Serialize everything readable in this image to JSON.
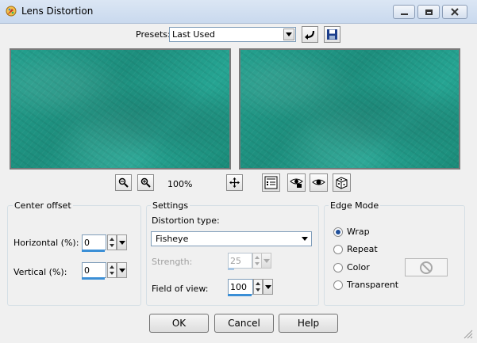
{
  "window": {
    "title": "Lens Distortion",
    "app_icon": "paint-shop-pro-icon"
  },
  "presets": {
    "label": "Presets:",
    "value": "Last Used"
  },
  "zoom": {
    "level": "100%"
  },
  "center_offset": {
    "title": "Center offset",
    "horizontal": {
      "label": "Horizontal (%):",
      "value": "0"
    },
    "vertical": {
      "label": "Vertical (%):",
      "value": "0"
    }
  },
  "settings": {
    "title": "Settings",
    "distortion_type_label": "Distortion type:",
    "distortion_type": "Fisheye",
    "strength": {
      "label": "Strength:",
      "value": "25"
    },
    "field_of_view": {
      "label": "Field of view:",
      "value": "100"
    }
  },
  "edge_mode": {
    "title": "Edge Mode",
    "options": [
      "Wrap",
      "Repeat",
      "Color",
      "Transparent"
    ],
    "selected": "Wrap"
  },
  "buttons": {
    "ok": "OK",
    "cancel": "Cancel",
    "help": "Help"
  },
  "colors": {
    "preview_teal": "#1f9886",
    "accent": "#3b8fd6"
  }
}
